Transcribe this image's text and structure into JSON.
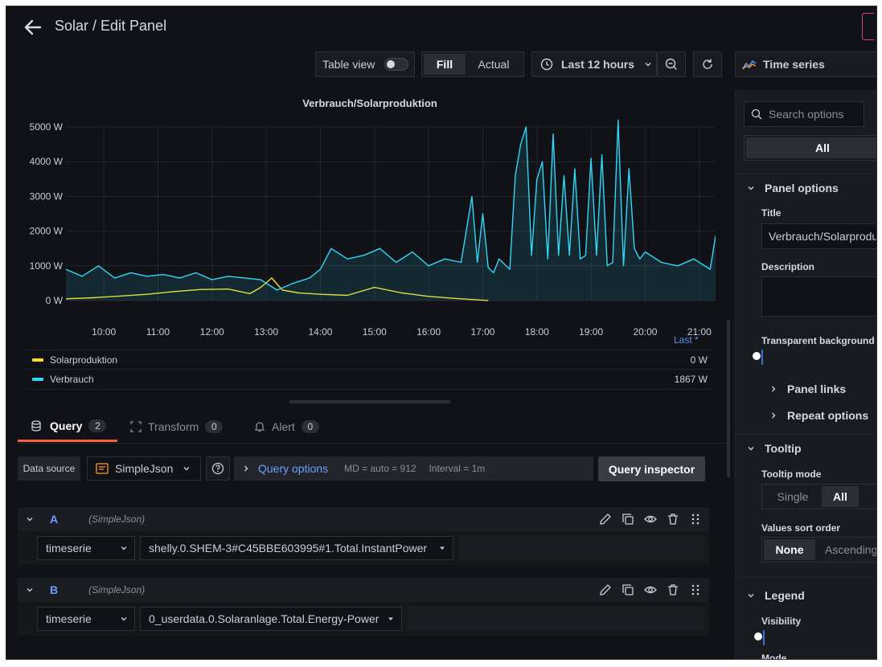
{
  "header": {
    "title": "Solar / Edit Panel"
  },
  "toolbar": {
    "table_view_label": "Table view",
    "fill_label": "Fill",
    "actual_label": "Actual",
    "time_range_label": "Last 12 hours",
    "viz_label": "Time series"
  },
  "panel": {
    "title": "Verbrauch/Solarproduktion",
    "last_label": "Last *"
  },
  "chart_data": {
    "type": "line",
    "title": "Verbrauch/Solarproduktion",
    "x_ticks": [
      "10:00",
      "11:00",
      "12:00",
      "13:00",
      "14:00",
      "15:00",
      "16:00",
      "17:00",
      "18:00",
      "19:00",
      "20:00",
      "21:00"
    ],
    "y_ticks": [
      "0 W",
      "1000 W",
      "2000 W",
      "3000 W",
      "4000 W",
      "5000 W"
    ],
    "ylim": [
      0,
      5000
    ],
    "xlim_hours": [
      9.3,
      21.3
    ],
    "series": [
      {
        "name": "Solarproduktion",
        "color": "#fade2a",
        "x": [
          9.3,
          9.8,
          10.3,
          10.8,
          11.3,
          11.8,
          12.3,
          12.7,
          12.9,
          13.1,
          13.3,
          13.6,
          14.0,
          14.5,
          15.0,
          15.5,
          16.0,
          16.5,
          17.0,
          17.1
        ],
        "y": [
          50,
          80,
          130,
          180,
          260,
          320,
          330,
          200,
          380,
          650,
          300,
          220,
          180,
          150,
          380,
          220,
          120,
          60,
          10,
          0
        ]
      },
      {
        "name": "Verbrauch",
        "color": "#33d6f4",
        "x": [
          9.3,
          9.6,
          9.9,
          10.2,
          10.5,
          10.8,
          11.1,
          11.4,
          11.7,
          12.0,
          12.3,
          12.6,
          12.9,
          13.2,
          13.5,
          13.8,
          14.0,
          14.2,
          14.5,
          14.8,
          15.1,
          15.4,
          15.7,
          16.0,
          16.3,
          16.6,
          16.8,
          16.9,
          17.0,
          17.1,
          17.2,
          17.3,
          17.5,
          17.6,
          17.7,
          17.8,
          17.9,
          18.0,
          18.1,
          18.2,
          18.3,
          18.4,
          18.5,
          18.6,
          18.7,
          18.8,
          18.9,
          19.0,
          19.1,
          19.2,
          19.3,
          19.4,
          19.5,
          19.6,
          19.7,
          19.8,
          19.9,
          20.0,
          20.3,
          20.6,
          20.9,
          21.2,
          21.3
        ],
        "y": [
          900,
          700,
          1000,
          650,
          800,
          700,
          750,
          650,
          800,
          600,
          700,
          650,
          600,
          300,
          500,
          650,
          900,
          1500,
          1200,
          1300,
          1500,
          1100,
          1400,
          1000,
          1200,
          1100,
          3000,
          1100,
          2500,
          950,
          800,
          1200,
          900,
          3600,
          4500,
          5000,
          1300,
          3500,
          4000,
          1200,
          4800,
          1300,
          3600,
          1300,
          3800,
          1200,
          1300,
          4100,
          1300,
          4200,
          1000,
          1100,
          5200,
          1000,
          3800,
          1500,
          1200,
          1400,
          1100,
          1000,
          1200,
          900,
          1867
        ]
      }
    ]
  },
  "legend": [
    {
      "name": "Solarproduktion",
      "value": "0 W",
      "color": "#fade2a"
    },
    {
      "name": "Verbrauch",
      "value": "1867 W",
      "color": "#33d6f4"
    }
  ],
  "tabs": [
    {
      "label": "Query",
      "count": "2"
    },
    {
      "label": "Transform",
      "count": "0"
    },
    {
      "label": "Alert",
      "count": "0"
    }
  ],
  "query_bar": {
    "data_source_label": "Data source",
    "data_source_value": "SimpleJson",
    "query_options_label": "Query options",
    "md_text": "MD = auto = 912",
    "interval_text": "Interval = 1m",
    "inspector_label": "Query inspector"
  },
  "queries": [
    {
      "ref": "A",
      "source": "(SimpleJson)",
      "type": "timeserie",
      "target": "shelly.0.SHEM-3#C45BBE603995#1.Total.InstantPower"
    },
    {
      "ref": "B",
      "source": "(SimpleJson)",
      "type": "timeserie",
      "target": "0_userdata.0.Solaranlage.Total.Energy-Power"
    }
  ],
  "options": {
    "search_placeholder": "Search options",
    "all_label": "All",
    "panel_options_label": "Panel options",
    "title_label": "Title",
    "title_value": "Verbrauch/Solarproduktion",
    "description_label": "Description",
    "transparent_label": "Transparent background",
    "panel_links_label": "Panel links",
    "repeat_options_label": "Repeat options",
    "tooltip_label": "Tooltip",
    "tooltip_mode_label": "Tooltip mode",
    "tooltip_single": "Single",
    "tooltip_all": "All",
    "values_sort_label": "Values sort order",
    "sort_none": "None",
    "sort_ascending": "Ascending",
    "legend_label": "Legend",
    "visibility_label": "Visibility",
    "mode_label": "Mode"
  }
}
